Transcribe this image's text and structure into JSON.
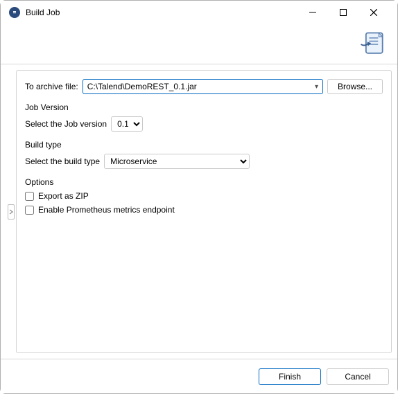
{
  "window": {
    "title": "Build Job"
  },
  "archive": {
    "label": "To archive file:",
    "value": "C:\\Talend\\DemoREST_0.1.jar",
    "browse": "Browse..."
  },
  "jobVersion": {
    "groupTitle": "Job Version",
    "label": "Select the Job version",
    "value": "0.1"
  },
  "buildType": {
    "groupTitle": "Build type",
    "label": "Select the build type",
    "value": "Microservice"
  },
  "options": {
    "groupTitle": "Options",
    "exportZip": "Export as ZIP",
    "prometheus": "Enable Prometheus metrics endpoint"
  },
  "footer": {
    "finish": "Finish",
    "cancel": "Cancel"
  }
}
